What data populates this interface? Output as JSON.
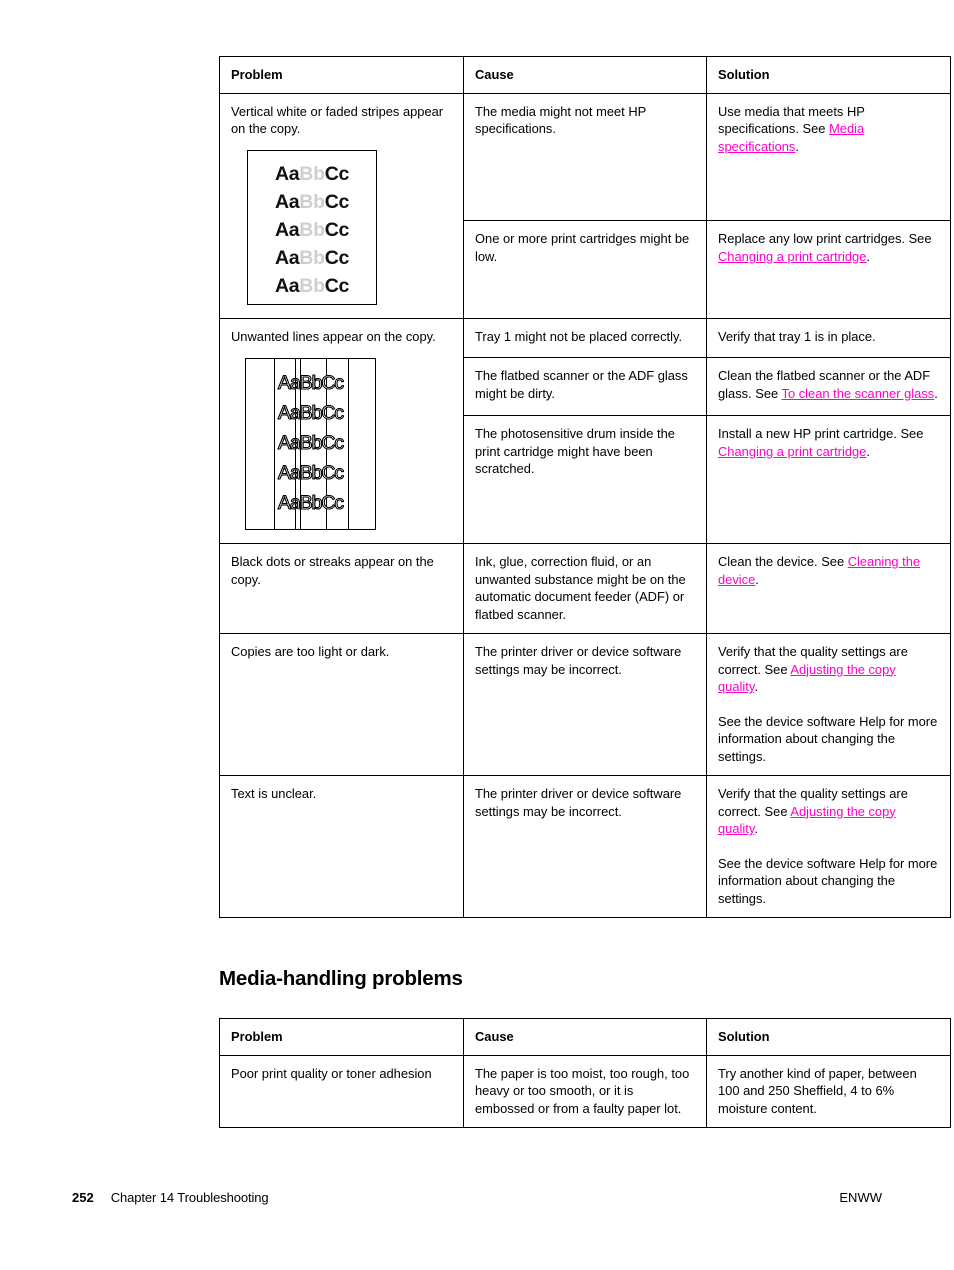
{
  "page": {
    "number": "252",
    "chapter_label": "Chapter 14  Troubleshooting",
    "locale_code": "ENWW"
  },
  "link_color": "#ff00cc",
  "sections": [
    {
      "id": "copy-problems",
      "heading": null,
      "table": {
        "headers": [
          "Problem",
          "Cause",
          "Solution"
        ],
        "rows": [
          {
            "problem": "Vertical white or faded stripes appear on the copy.",
            "sample": "faded-stripes",
            "cause": "The media might not meet HP specifications.",
            "solution_parts": [
              {
                "text": "Use media that meets HP specifications. See ",
                "link": false
              },
              {
                "text": "Media specifications",
                "link": true
              },
              {
                "text": ".",
                "link": false
              }
            ]
          },
          {
            "problem": null,
            "cause": "One or more print cartridges might be low.",
            "solution_parts": [
              {
                "text": "Replace any low print cartridges. See ",
                "link": false
              },
              {
                "text": "Changing a print cartridge",
                "link": true
              },
              {
                "text": ".",
                "link": false
              }
            ]
          },
          {
            "problem": "Unwanted lines appear on the copy.",
            "sample": "unwanted-lines",
            "cause": "Tray 1 might not be placed correctly.",
            "solution_parts": [
              {
                "text": "Verify that tray 1 is in place.",
                "link": false
              }
            ]
          },
          {
            "problem": null,
            "cause": "The flatbed scanner or the ADF glass might be dirty.",
            "solution_parts": [
              {
                "text": "Clean the flatbed scanner or the ADF glass. See ",
                "link": false
              },
              {
                "text": "To clean the scanner glass",
                "link": true
              },
              {
                "text": ".",
                "link": false
              }
            ]
          },
          {
            "problem": null,
            "cause": "The photosensitive drum inside the print cartridge might have been scratched.",
            "solution_parts": [
              {
                "text": "Install a new HP print cartridge. See ",
                "link": false
              },
              {
                "text": "Changing a print cartridge",
                "link": true
              },
              {
                "text": ".",
                "link": false
              }
            ]
          },
          {
            "problem": "Black dots or streaks appear on the copy.",
            "cause": "Ink, glue, correction fluid, or an unwanted substance might be on the automatic document feeder (ADF) or flatbed scanner.",
            "solution_parts": [
              {
                "text": "Clean the device. See ",
                "link": false
              },
              {
                "text": "Cleaning the device",
                "link": true
              },
              {
                "text": ".",
                "link": false
              }
            ]
          },
          {
            "problem": "Copies are too light or dark.",
            "cause": "The printer driver or device software settings may be incorrect.",
            "solution_parts": [
              {
                "text": "Verify that the quality settings are correct. See ",
                "link": false
              },
              {
                "text": "Adjusting the copy quality",
                "link": true
              },
              {
                "text": ".",
                "link": false
              }
            ],
            "solution_extra": "See the device software Help for more information about changing the settings."
          },
          {
            "problem": "Text is unclear.",
            "cause": "The printer driver or device software settings may be incorrect.",
            "solution_parts": [
              {
                "text": "Verify that the quality settings are correct. See ",
                "link": false
              },
              {
                "text": "Adjusting the copy quality",
                "link": true
              },
              {
                "text": ".",
                "link": false
              }
            ],
            "solution_extra": "See the device software Help for more information about changing the settings."
          }
        ]
      }
    },
    {
      "id": "media-handling-problems",
      "heading": "Media-handling problems",
      "table": {
        "headers": [
          "Problem",
          "Cause",
          "Solution"
        ],
        "rows": [
          {
            "problem": "Poor print quality or toner adhesion",
            "cause": "The paper is too moist, too rough, too heavy or too smooth, or it is embossed or from a faulty paper lot.",
            "solution_parts": [
              {
                "text": "Try another kind of paper, between 100 and 250 Sheffield, 4 to 6% moisture content.",
                "link": false
              }
            ]
          }
        ]
      }
    }
  ],
  "samples": {
    "faded_stripes": {
      "line_count": 5,
      "segments": [
        {
          "text": "Aa",
          "shade": "dark"
        },
        {
          "text": "Bb",
          "shade": "faded"
        },
        {
          "text": "Cc",
          "shade": "dark"
        }
      ]
    },
    "unwanted_lines": {
      "line_count": 5,
      "text": "AaBbCc",
      "streak_positions_pct": [
        22,
        38,
        42,
        62,
        79
      ]
    }
  }
}
